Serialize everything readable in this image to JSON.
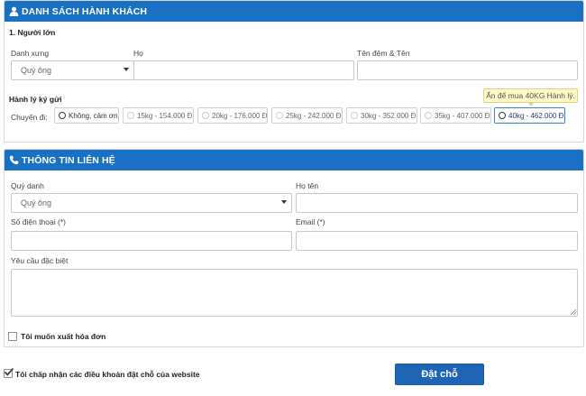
{
  "passenger_section": {
    "title": "DANH SÁCH HÀNH KHÁCH",
    "adult_heading": "1. Người lớn",
    "title_label": "Danh xưng",
    "title_select_value": "Quý ông",
    "last_name_label": "Họ",
    "first_name_label": "Tên đệm & Tên",
    "last_name_value": "",
    "first_name_value": "",
    "baggage_heading": "Hành lý ký gửi",
    "flight_label": "Chuyến đi:",
    "baggage_options": [
      "Không, cảm ơn",
      "15kg - 154.000 Đ",
      "20kg - 176.000 Đ",
      "25kg - 242.000 Đ",
      "30kg - 352.000 Đ",
      "35kg - 407.000 Đ",
      "40kg - 462.000 Đ"
    ],
    "tooltip": "Ấn để mua 40KG Hành lý."
  },
  "contact_section": {
    "title": "THÔNG TIN LIÊN HỆ",
    "salutation_label": "Quý danh",
    "salutation_value": "Quý ông",
    "fullname_label": "Họ tên",
    "fullname_value": "",
    "phone_label": "Số điện thoại (*)",
    "phone_value": "",
    "email_label": "Email (*)",
    "email_value": "",
    "special_label": "Yêu cầu đặc biệt",
    "special_value": "",
    "invoice_label": "Tôi muốn xuất hóa đơn"
  },
  "footer": {
    "terms_label": "Tôi chấp nhận các điều khoản đặt chỗ của website",
    "submit_label": "Đặt chỗ"
  },
  "colors": {
    "header_blue": "#1a71c4",
    "button_blue": "#1d64b6",
    "tooltip_bg": "#fff8c8"
  }
}
